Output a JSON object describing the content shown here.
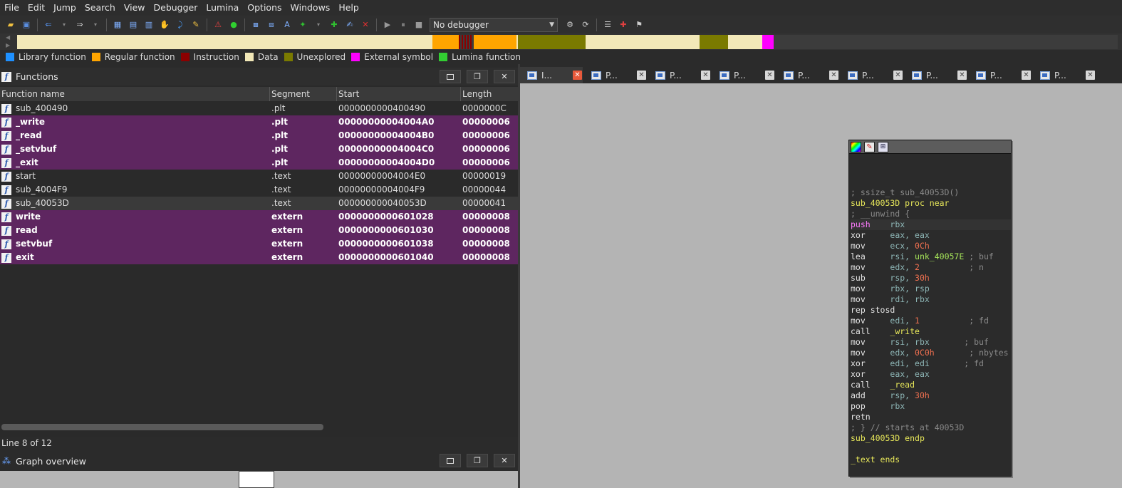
{
  "menu": [
    "File",
    "Edit",
    "Jump",
    "Search",
    "View",
    "Debugger",
    "Lumina",
    "Options",
    "Windows",
    "Help"
  ],
  "toolbar": {
    "debugger_value": "No debugger"
  },
  "navband_colors": {
    "data": "#f2e8b8",
    "regular": "#ffa500",
    "instruction": "#8b0000",
    "unexplored": "#7a7a00",
    "external": "#ff00ff"
  },
  "legend": [
    {
      "label": "Library function",
      "color": "#1e90ff"
    },
    {
      "label": "Regular function",
      "color": "#ffa500"
    },
    {
      "label": "Instruction",
      "color": "#8b0000"
    },
    {
      "label": "Data",
      "color": "#f2e8b8"
    },
    {
      "label": "Unexplored",
      "color": "#7a7a00"
    },
    {
      "label": "External symbol",
      "color": "#ff00ff"
    },
    {
      "label": "Lumina function",
      "color": "#32cd32"
    }
  ],
  "functions_panel": {
    "title": "Functions",
    "columns": [
      "Function name",
      "Segment",
      "Start",
      "Length"
    ],
    "rows": [
      {
        "name": "sub_400490",
        "segment": ".plt",
        "start": "0000000000400490",
        "length": "0000000C",
        "kind": "normal"
      },
      {
        "name": "_write",
        "segment": ".plt",
        "start": "00000000004004A0",
        "length": "00000006",
        "kind": "extern"
      },
      {
        "name": "_read",
        "segment": ".plt",
        "start": "00000000004004B0",
        "length": "00000006",
        "kind": "extern"
      },
      {
        "name": "_setvbuf",
        "segment": ".plt",
        "start": "00000000004004C0",
        "length": "00000006",
        "kind": "extern"
      },
      {
        "name": "_exit",
        "segment": ".plt",
        "start": "00000000004004D0",
        "length": "00000006",
        "kind": "extern"
      },
      {
        "name": "start",
        "segment": ".text",
        "start": "00000000004004E0",
        "length": "00000019",
        "kind": "normal"
      },
      {
        "name": "sub_4004F9",
        "segment": ".text",
        "start": "00000000004004F9",
        "length": "00000044",
        "kind": "normal"
      },
      {
        "name": "sub_40053D",
        "segment": ".text",
        "start": "000000000040053D",
        "length": "00000041",
        "kind": "selected"
      },
      {
        "name": "write",
        "segment": "extern",
        "start": "0000000000601028",
        "length": "00000008",
        "kind": "extern"
      },
      {
        "name": "read",
        "segment": "extern",
        "start": "0000000000601030",
        "length": "00000008",
        "kind": "extern"
      },
      {
        "name": "setvbuf",
        "segment": "extern",
        "start": "0000000000601038",
        "length": "00000008",
        "kind": "extern"
      },
      {
        "name": "exit",
        "segment": "extern",
        "start": "0000000000601040",
        "length": "00000008",
        "kind": "extern"
      }
    ],
    "status": "Line 8 of 12"
  },
  "graph_overview": {
    "title": "Graph overview"
  },
  "tabs": [
    {
      "label": "I...",
      "active": true
    },
    {
      "label": "P...",
      "active": false
    },
    {
      "label": "P...",
      "active": false
    },
    {
      "label": "P...",
      "active": false
    },
    {
      "label": "P...",
      "active": false
    },
    {
      "label": "P...",
      "active": false
    },
    {
      "label": "P...",
      "active": false
    },
    {
      "label": "P...",
      "active": false
    },
    {
      "label": "P...",
      "active": false
    }
  ],
  "disasm": [
    {
      "parts": [
        [
          "cm",
          "; ssize_t sub_40053D()"
        ]
      ]
    },
    {
      "parts": [
        [
          "lbl",
          "sub_40053D"
        ],
        [
          "kw",
          " proc near"
        ]
      ]
    },
    {
      "parts": [
        [
          "cm",
          "; __unwind {"
        ]
      ]
    },
    {
      "parts": [
        [
          "mn-hl",
          "push"
        ],
        [
          "rg",
          "    rbx"
        ]
      ],
      "hl": true
    },
    {
      "parts": [
        [
          "mn",
          "xor"
        ],
        [
          "rg",
          "     eax, eax"
        ]
      ]
    },
    {
      "parts": [
        [
          "mn",
          "mov"
        ],
        [
          "rg",
          "     ecx, "
        ],
        [
          "num",
          "0Ch"
        ]
      ]
    },
    {
      "parts": [
        [
          "mn",
          "lea"
        ],
        [
          "rg",
          "     rsi, "
        ],
        [
          "nm-green",
          "unk_40057E"
        ],
        [
          "cm",
          " ; buf"
        ]
      ]
    },
    {
      "parts": [
        [
          "mn",
          "mov"
        ],
        [
          "rg",
          "     edx, "
        ],
        [
          "num",
          "2"
        ],
        [
          "cm",
          "          ; n"
        ]
      ]
    },
    {
      "parts": [
        [
          "mn",
          "sub"
        ],
        [
          "rg",
          "     rsp, "
        ],
        [
          "num",
          "30h"
        ]
      ]
    },
    {
      "parts": [
        [
          "mn",
          "mov"
        ],
        [
          "rg",
          "     rbx, rsp"
        ]
      ]
    },
    {
      "parts": [
        [
          "mn",
          "mov"
        ],
        [
          "rg",
          "     rdi, rbx"
        ]
      ]
    },
    {
      "parts": [
        [
          "mn",
          "rep stosd"
        ]
      ]
    },
    {
      "parts": [
        [
          "mn",
          "mov"
        ],
        [
          "rg",
          "     edi, "
        ],
        [
          "num",
          "1"
        ],
        [
          "cm",
          "          ; fd"
        ]
      ]
    },
    {
      "parts": [
        [
          "mn",
          "call"
        ],
        [
          "fn-call",
          "    _write"
        ]
      ]
    },
    {
      "parts": [
        [
          "mn",
          "mov"
        ],
        [
          "rg",
          "     rsi, rbx"
        ],
        [
          "cm",
          "       ; buf"
        ]
      ]
    },
    {
      "parts": [
        [
          "mn",
          "mov"
        ],
        [
          "rg",
          "     edx, "
        ],
        [
          "num",
          "0C0h"
        ],
        [
          "cm",
          "       ; nbytes"
        ]
      ]
    },
    {
      "parts": [
        [
          "mn",
          "xor"
        ],
        [
          "rg",
          "     edi, edi"
        ],
        [
          "cm",
          "       ; fd"
        ]
      ]
    },
    {
      "parts": [
        [
          "mn",
          "xor"
        ],
        [
          "rg",
          "     eax, eax"
        ]
      ]
    },
    {
      "parts": [
        [
          "mn",
          "call"
        ],
        [
          "fn-call",
          "    _read"
        ]
      ]
    },
    {
      "parts": [
        [
          "mn",
          "add"
        ],
        [
          "rg",
          "     rsp, "
        ],
        [
          "num",
          "30h"
        ]
      ]
    },
    {
      "parts": [
        [
          "mn",
          "pop"
        ],
        [
          "rg",
          "     rbx"
        ]
      ]
    },
    {
      "parts": [
        [
          "mn",
          "retn"
        ]
      ]
    },
    {
      "parts": [
        [
          "cm",
          "; } // starts at 40053D"
        ]
      ]
    },
    {
      "parts": [
        [
          "lbl",
          "sub_40053D"
        ],
        [
          "kw",
          " endp"
        ]
      ]
    },
    {
      "parts": [
        [
          "txt",
          ""
        ]
      ]
    },
    {
      "parts": [
        [
          "lbl",
          "_text ends"
        ]
      ]
    }
  ]
}
